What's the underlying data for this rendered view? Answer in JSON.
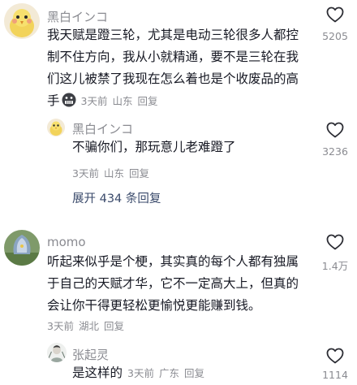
{
  "comments": [
    {
      "username": "黑白インコ",
      "lines": [
        "我天赋是蹬三轮，尤其是电动三轮很多人都控",
        "制不住方向，我从小就精通，要不是三轮在我",
        "们这儿被禁了我现在怎么着也是个收废品的高",
        "手"
      ],
      "emoji": "grimacing-face-emoji",
      "time": "3天前",
      "location": "山东",
      "reply_label": "回复",
      "likes": "5205",
      "reply": {
        "username": "黑白インコ",
        "text": "不骗你们，那玩意儿老难蹬了",
        "time": "3天前",
        "location": "山东",
        "reply_label": "回复",
        "likes": "3236"
      },
      "expand_label": "展开 434 条回复"
    },
    {
      "username": "momo",
      "lines": [
        "听起来似乎是个梗，其实真的每个人都有独属",
        "于自己的天赋才华，它不一定高大上，但真的",
        "会让你干得更轻松更愉悦更能赚到钱。"
      ],
      "time": "3天前",
      "location": "湖北",
      "reply_label": "回复",
      "likes": "1.4万",
      "reply": {
        "username": "张起灵",
        "text": "是这样的",
        "time": "3天前",
        "location": "广东",
        "reply_label": "回复",
        "likes": "1114"
      }
    }
  ],
  "colors": {
    "text": "#161823",
    "secondary": "#8a8b91",
    "link": "#3a4a6b"
  }
}
